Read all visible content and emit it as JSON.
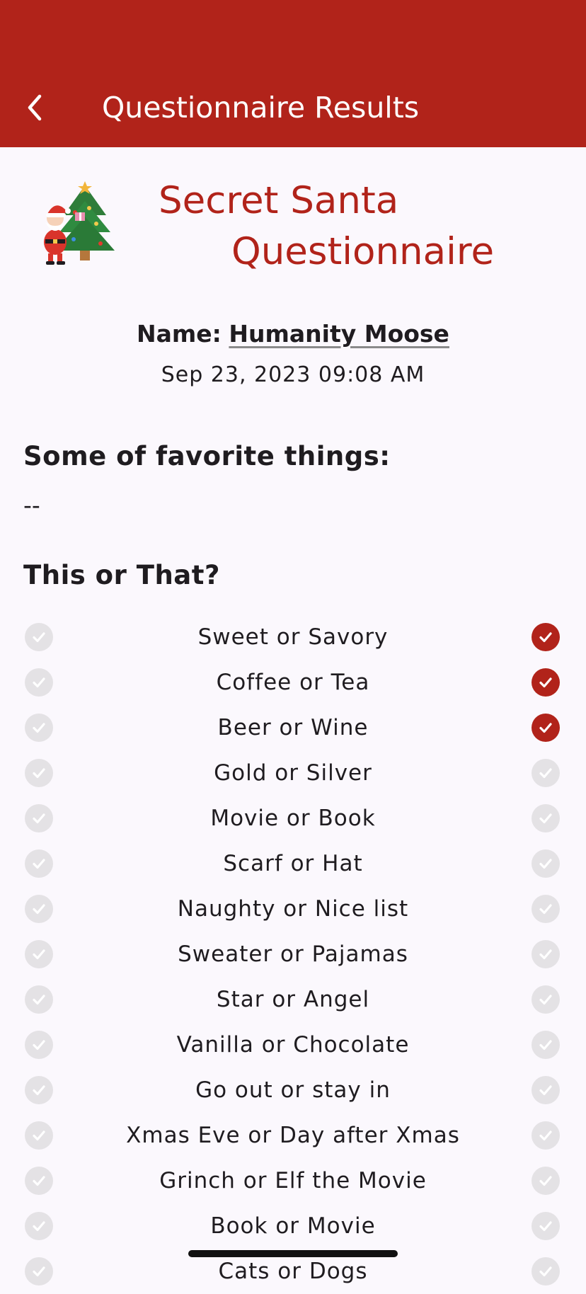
{
  "app_bar": {
    "back_icon": "chevron-left-icon",
    "title": "Questionnaire Results",
    "background": "#b1231a"
  },
  "hero": {
    "logo": "santa-christmas-tree-logo",
    "title_line1": "Secret Santa",
    "title_line2": "Questionnaire",
    "accent_color": "#b1231a"
  },
  "person": {
    "name_label": "Name:",
    "name_value": "Humanity Moose",
    "date": "Sep 23, 2023 09:08 AM"
  },
  "favorites": {
    "heading": "Some of favorite things:",
    "value": "--"
  },
  "this_or_that": {
    "heading": "This or That?",
    "options": [
      {
        "label": "Sweet or Savory",
        "left_selected": false,
        "right_selected": true
      },
      {
        "label": "Coffee or Tea",
        "left_selected": false,
        "right_selected": true
      },
      {
        "label": "Beer or Wine",
        "left_selected": false,
        "right_selected": true
      },
      {
        "label": "Gold or Silver",
        "left_selected": false,
        "right_selected": false
      },
      {
        "label": "Movie or Book",
        "left_selected": false,
        "right_selected": false
      },
      {
        "label": "Scarf or Hat",
        "left_selected": false,
        "right_selected": false
      },
      {
        "label": "Naughty or Nice list",
        "left_selected": false,
        "right_selected": false
      },
      {
        "label": "Sweater or Pajamas",
        "left_selected": false,
        "right_selected": false
      },
      {
        "label": "Star or Angel",
        "left_selected": false,
        "right_selected": false
      },
      {
        "label": "Vanilla or Chocolate",
        "left_selected": false,
        "right_selected": false
      },
      {
        "label": "Go out or stay in",
        "left_selected": false,
        "right_selected": false
      },
      {
        "label": "Xmas Eve or Day after Xmas",
        "left_selected": false,
        "right_selected": false
      },
      {
        "label": "Grinch or Elf the Movie",
        "left_selected": false,
        "right_selected": false
      },
      {
        "label": "Book or Movie",
        "left_selected": false,
        "right_selected": false
      },
      {
        "label": "Cats or Dogs",
        "left_selected": false,
        "right_selected": false
      }
    ]
  },
  "colors": {
    "selected": "#b1231a",
    "unselected": "#e4e2e5"
  }
}
